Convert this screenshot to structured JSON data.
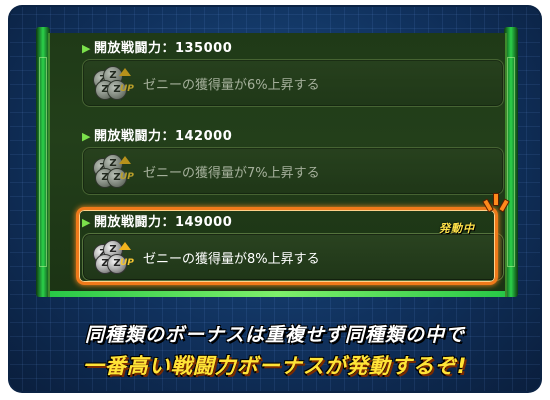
{
  "bonuses": [
    {
      "header": "開放戦闘力：135000",
      "effect": "ゼニーの獲得量が6%上昇する",
      "active": false
    },
    {
      "header": "開放戦闘力：142000",
      "effect": "ゼニーの獲得量が7%上昇する",
      "active": false
    },
    {
      "header": "開放戦闘力：149000",
      "effect": "ゼニーの獲得量が8%上昇する",
      "active": true
    }
  ],
  "active_badge": "発動中",
  "icon": {
    "label": "UP",
    "coin_glyph": "Z",
    "name": "zeni-up-icon"
  },
  "caption": {
    "line1": "同種類のボーナスは重複せず同種類の中で",
    "line2": "一番高い戦闘力ボーナスが発動するぞ!"
  },
  "colors": {
    "accent_green": "#2bd24a",
    "highlight_orange": "#f07a1a",
    "caption_yellow": "#ffe437"
  }
}
